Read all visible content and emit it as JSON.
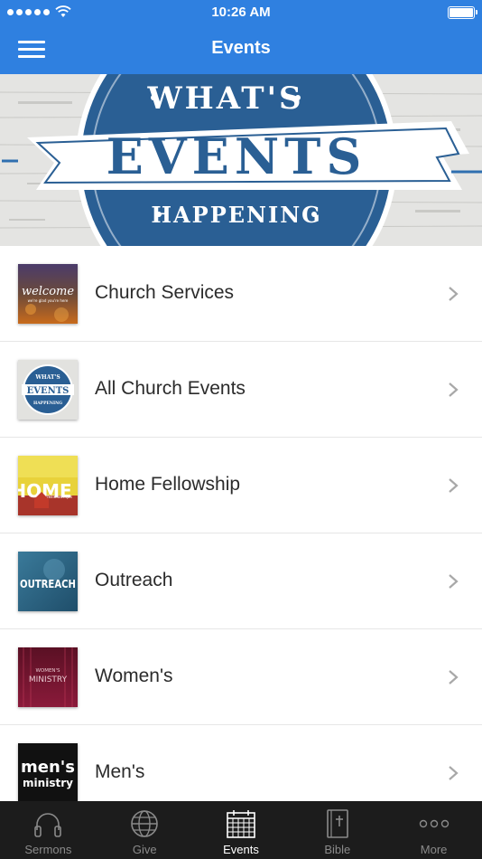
{
  "status_bar": {
    "time": "10:26 AM"
  },
  "header": {
    "title": "Events"
  },
  "banner": {
    "line1": "WHAT'S",
    "line2": "EVENTS",
    "line3": "HAPPENING"
  },
  "list": {
    "items": [
      {
        "label": "Church Services",
        "thumb_text": "welcome",
        "thumb_subtext": "we're glad you're here",
        "icon": "welcome-thumbnail"
      },
      {
        "label": "All Church Events",
        "thumb_text": "EVENTS",
        "thumb_subtext_top": "WHAT'S",
        "thumb_subtext_bottom": "HAPPENING",
        "icon": "events-thumbnail"
      },
      {
        "label": "Home Fellowship",
        "thumb_text": "HOME",
        "thumb_subtext": "fellowships",
        "icon": "home-fellowship-thumbnail"
      },
      {
        "label": "Outreach",
        "thumb_text": "OUTREACH",
        "icon": "outreach-thumbnail"
      },
      {
        "label": "Women's",
        "thumb_text": "MINISTRY",
        "thumb_subtext": "WOMEN'S",
        "icon": "womens-ministry-thumbnail"
      },
      {
        "label": "Men's",
        "thumb_text": "men's",
        "thumb_subtext": "ministry",
        "icon": "mens-ministry-thumbnail"
      }
    ]
  },
  "tab_bar": {
    "tabs": [
      {
        "label": "Sermons",
        "icon": "headphones-icon",
        "active": false
      },
      {
        "label": "Give",
        "icon": "globe-icon",
        "active": false
      },
      {
        "label": "Events",
        "icon": "calendar-icon",
        "active": true
      },
      {
        "label": "Bible",
        "icon": "bible-icon",
        "active": false
      },
      {
        "label": "More",
        "icon": "more-icon",
        "active": false
      }
    ]
  },
  "colors": {
    "accent": "#2f80e0",
    "badge_blue": "#2a5f94",
    "tab_bar_bg": "#1c1c1c"
  }
}
